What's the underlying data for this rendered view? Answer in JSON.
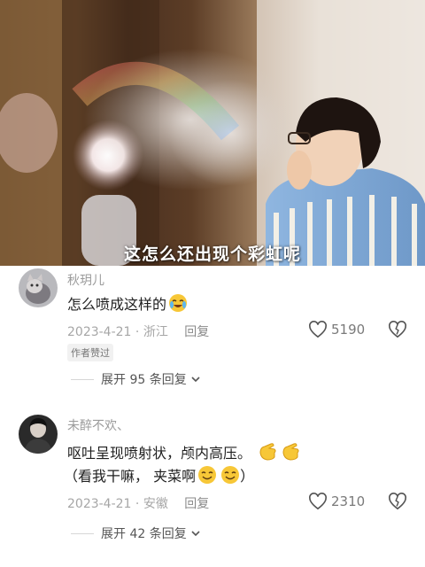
{
  "video": {
    "caption": "这怎么还出现个彩虹呢"
  },
  "comments": [
    {
      "username": "秋玥儿",
      "text": "怎么喷成这样的",
      "date": "2023-4-21",
      "location": "浙江",
      "reply_label": "回复",
      "likes": "5190",
      "badge": "作者赞过",
      "expand_label": "展开 95 条回复",
      "avatar_icon": "cat-avatar",
      "emoji_icon": "crying-laughing-emoji"
    },
    {
      "username": "未醉不欢、",
      "text_line1": "呕吐呈现喷射状，颅内高压。",
      "text_line2_prefix": "（看我干嘛，  夹菜啊",
      "text_line2_suffix": "）",
      "date": "2023-4-21",
      "location": "安徽",
      "reply_label": "回复",
      "likes": "2310",
      "expand_label": "展开 42 条回复",
      "avatar_icon": "person-avatar",
      "emoji_icons": [
        "pointing-hand-emoji",
        "pointing-hand-emoji",
        "smile-emoji",
        "smile-emoji"
      ]
    }
  ],
  "icons": {
    "heart": "heart-outline-icon",
    "dislike": "broken-heart-icon",
    "chevron": "chevron-down-icon"
  },
  "colors": {
    "text": "#1f1f1f",
    "muted": "#a6a6a6",
    "emoji_yellow": "#f7c737"
  }
}
